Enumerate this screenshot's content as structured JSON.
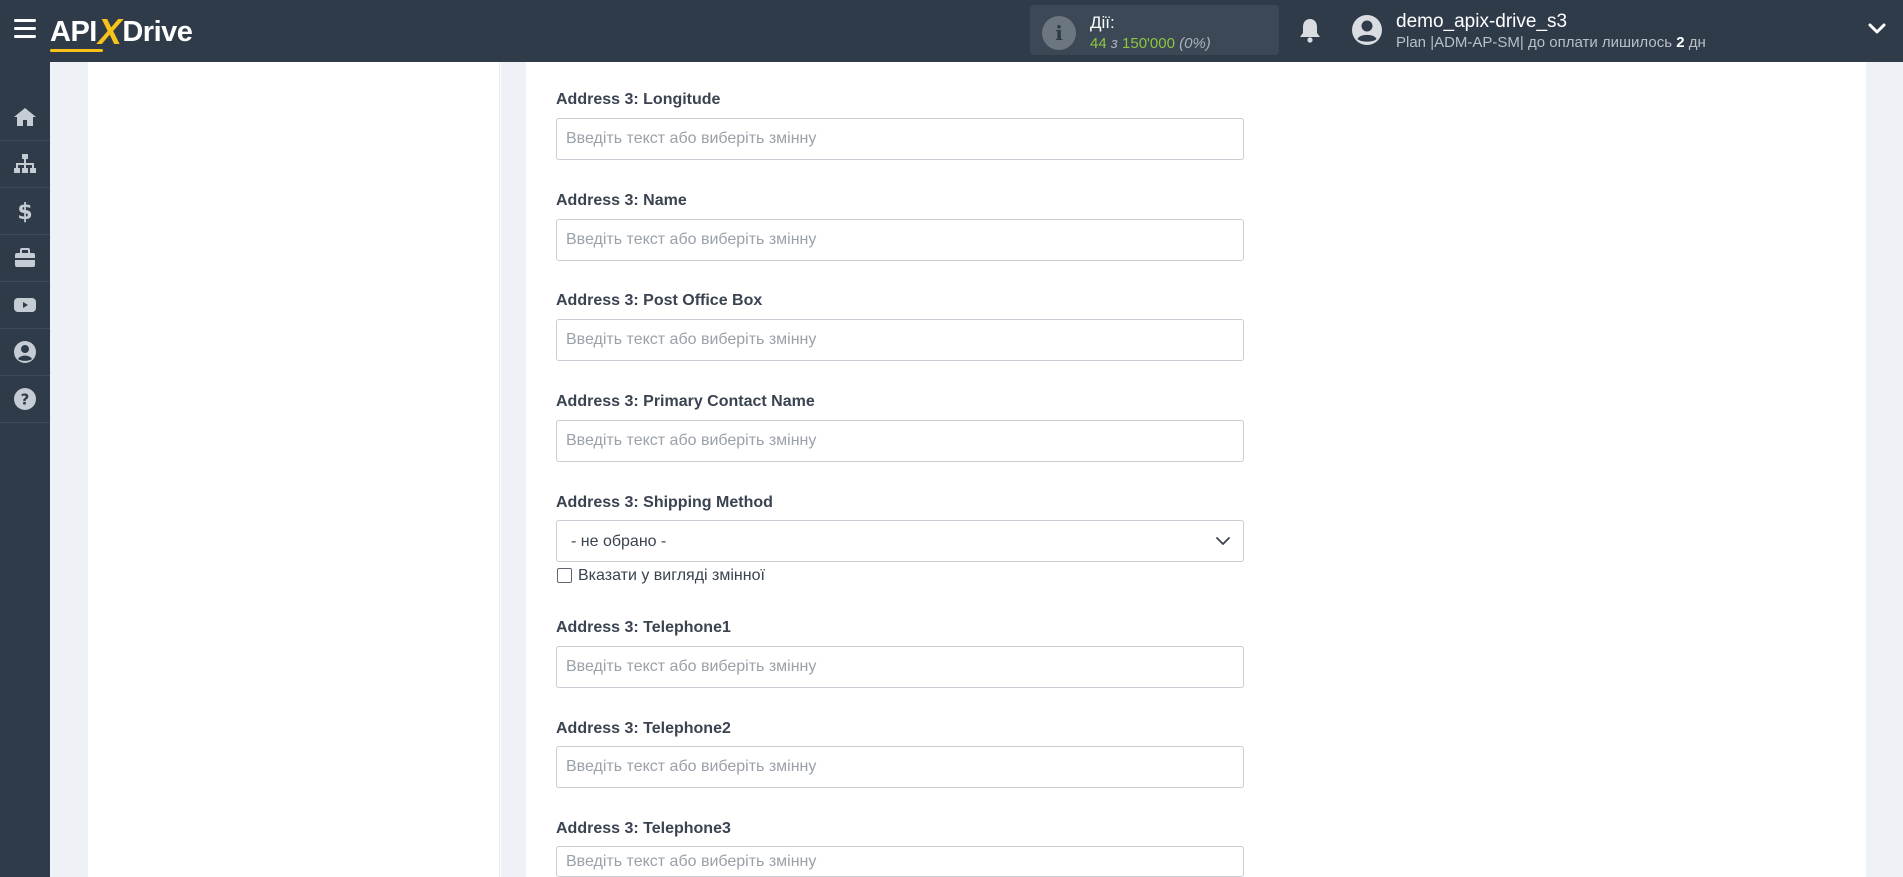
{
  "header": {
    "logo": {
      "part1": "API",
      "part2": "X",
      "part3": "Drive"
    },
    "actions": {
      "label": "Дії:",
      "used": "44",
      "separator": "з",
      "limit": "150'000",
      "percent": "(0%)"
    },
    "user": {
      "name": "demo_apix-drive_s3",
      "plan_prefix": "Plan |ADM-AP-SM| до оплати лишилось",
      "days": "2",
      "days_unit": "дн"
    }
  },
  "sidebar": {
    "items": [
      {
        "icon": "home-icon"
      },
      {
        "icon": "sitemap-icon"
      },
      {
        "icon": "dollar-icon"
      },
      {
        "icon": "briefcase-icon"
      },
      {
        "icon": "youtube-icon"
      },
      {
        "icon": "user-circle-icon"
      },
      {
        "icon": "question-icon"
      }
    ]
  },
  "form": {
    "placeholder": "Введіть текст або виберіть змінну",
    "fields": [
      {
        "label": "Address 3: Longitude"
      },
      {
        "label": "Address 3: Name"
      },
      {
        "label": "Address 3: Post Office Box"
      },
      {
        "label": "Address 3: Primary Contact Name"
      },
      {
        "label": "Address 3: Shipping Method",
        "select_value": "- не обрано -",
        "checkbox_label": "Вказати у вигляді змінної"
      },
      {
        "label": "Address 3: Telephone1"
      },
      {
        "label": "Address 3: Telephone2"
      },
      {
        "label": "Address 3: Telephone3"
      }
    ]
  },
  "colors": {
    "topbar": "#2f3b49",
    "accent_yellow": "#f7c31a",
    "actions_green": "#8dc63f"
  }
}
